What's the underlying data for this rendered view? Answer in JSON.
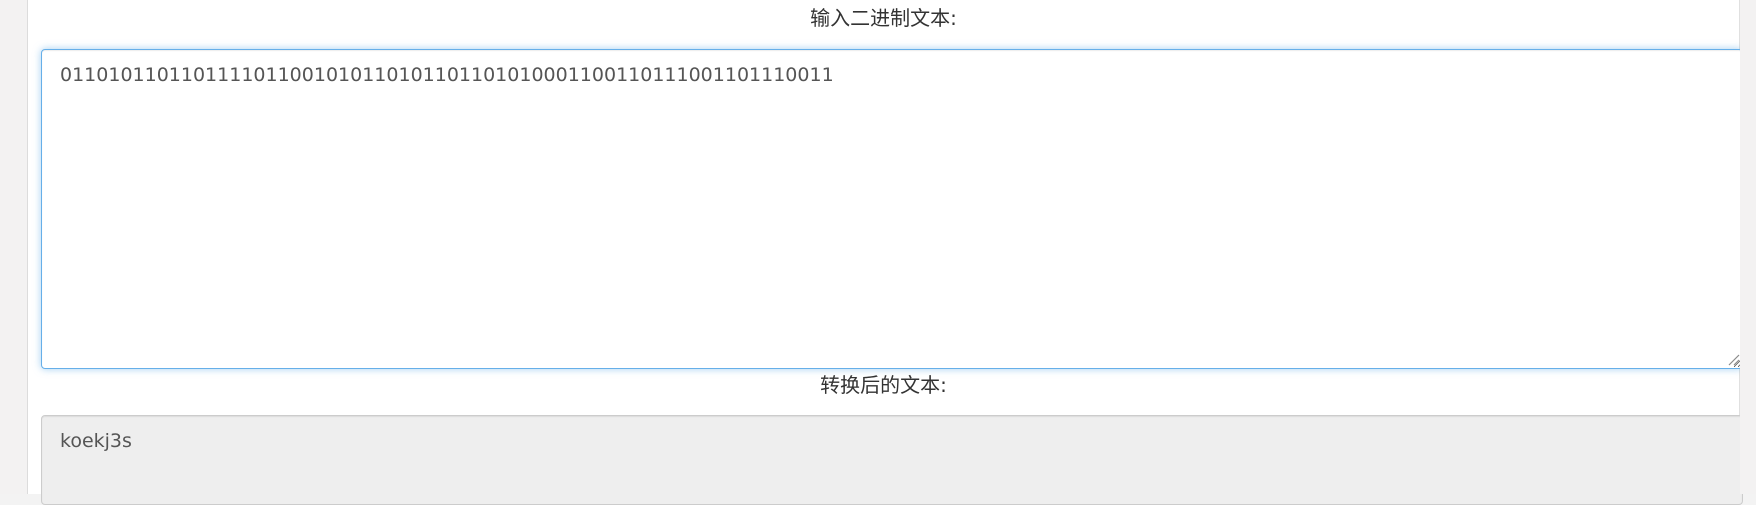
{
  "converter": {
    "input_label": "输入二进制文本:",
    "input_value": "0110101101101111011001010110101101101010001100110111001101110011",
    "output_label": "转换后的文本:",
    "output_value": "koekj3s"
  },
  "colors": {
    "focus_border": "#66afe9",
    "readonly_background": "#eeeeee"
  }
}
